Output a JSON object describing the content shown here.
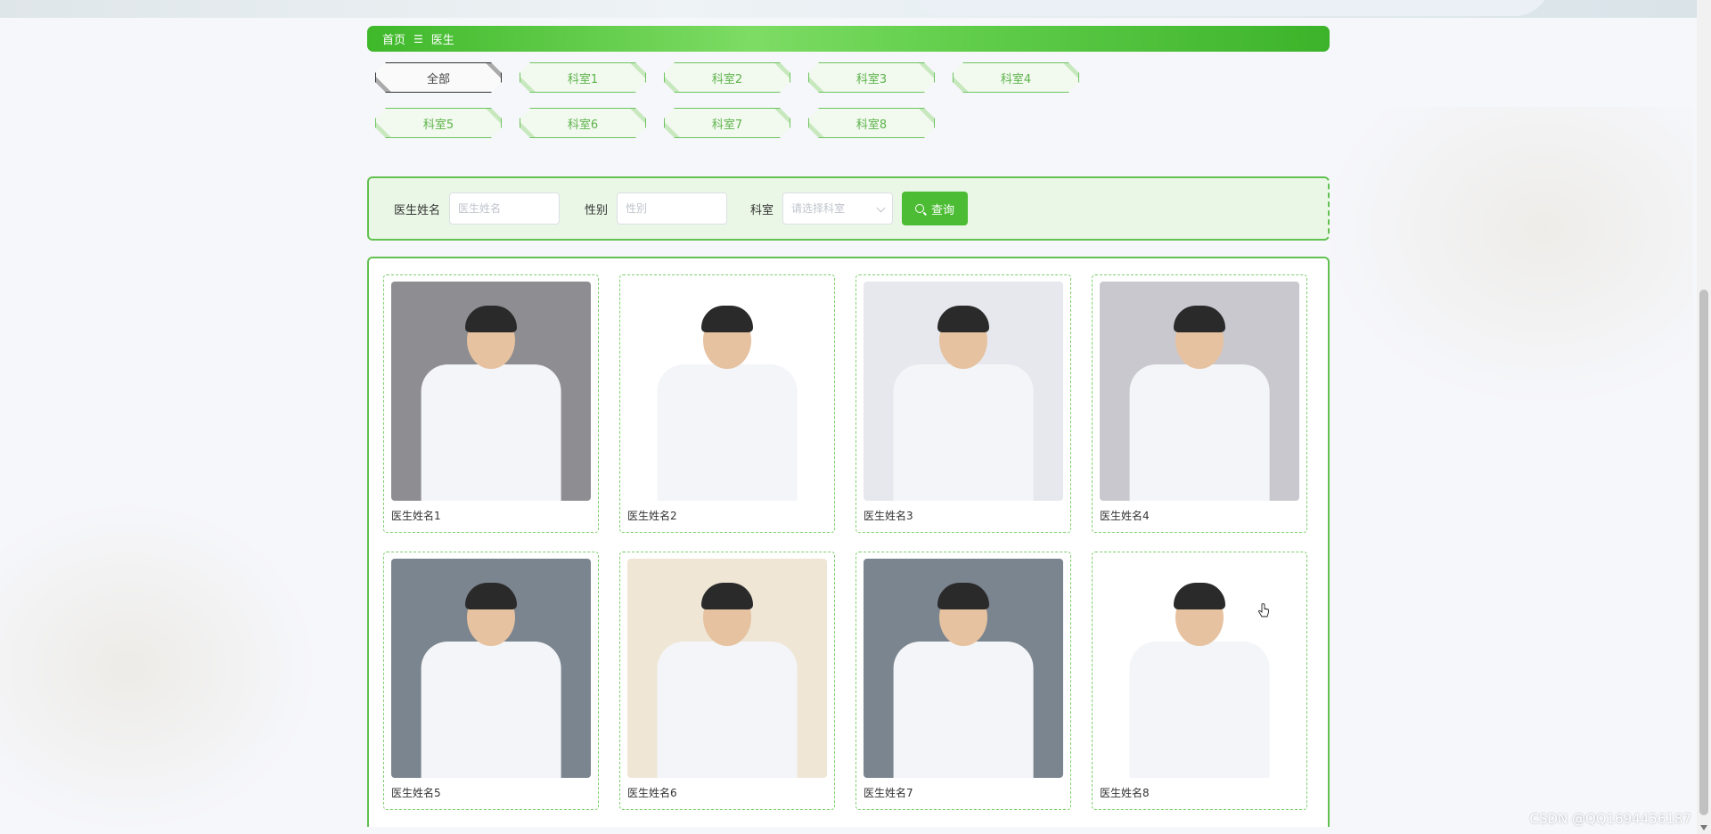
{
  "breadcrumb": {
    "home": "首页",
    "separator": "☰",
    "current": "医生"
  },
  "tabs": [
    {
      "label": "全部",
      "active": true
    },
    {
      "label": "科室1"
    },
    {
      "label": "科室2"
    },
    {
      "label": "科室3"
    },
    {
      "label": "科室4"
    },
    {
      "label": "科室5"
    },
    {
      "label": "科室6"
    },
    {
      "label": "科室7"
    },
    {
      "label": "科室8"
    }
  ],
  "search": {
    "name_label": "医生姓名",
    "name_placeholder": "医生姓名",
    "gender_label": "性别",
    "gender_placeholder": "性别",
    "dept_label": "科室",
    "dept_placeholder": "请选择科室",
    "query_label": "查询"
  },
  "doctors": [
    {
      "name": "医生姓名1",
      "bg": "#8e8d92"
    },
    {
      "name": "医生姓名2",
      "bg": "#ffffff"
    },
    {
      "name": "医生姓名3",
      "bg": "#e7e8ee"
    },
    {
      "name": "医生姓名4",
      "bg": "#c9c8cf"
    },
    {
      "name": "医生姓名5",
      "bg": "#7b8590"
    },
    {
      "name": "医生姓名6",
      "bg": "#efe6d6"
    },
    {
      "name": "医生姓名7",
      "bg": "#7b8590"
    },
    {
      "name": "医生姓名8",
      "bg": "#ffffff"
    }
  ],
  "watermark": "CSDN @QQ1694456187",
  "colors": {
    "accent": "#4cbc34",
    "border": "#62c150",
    "panel": "#eaf7e6"
  }
}
